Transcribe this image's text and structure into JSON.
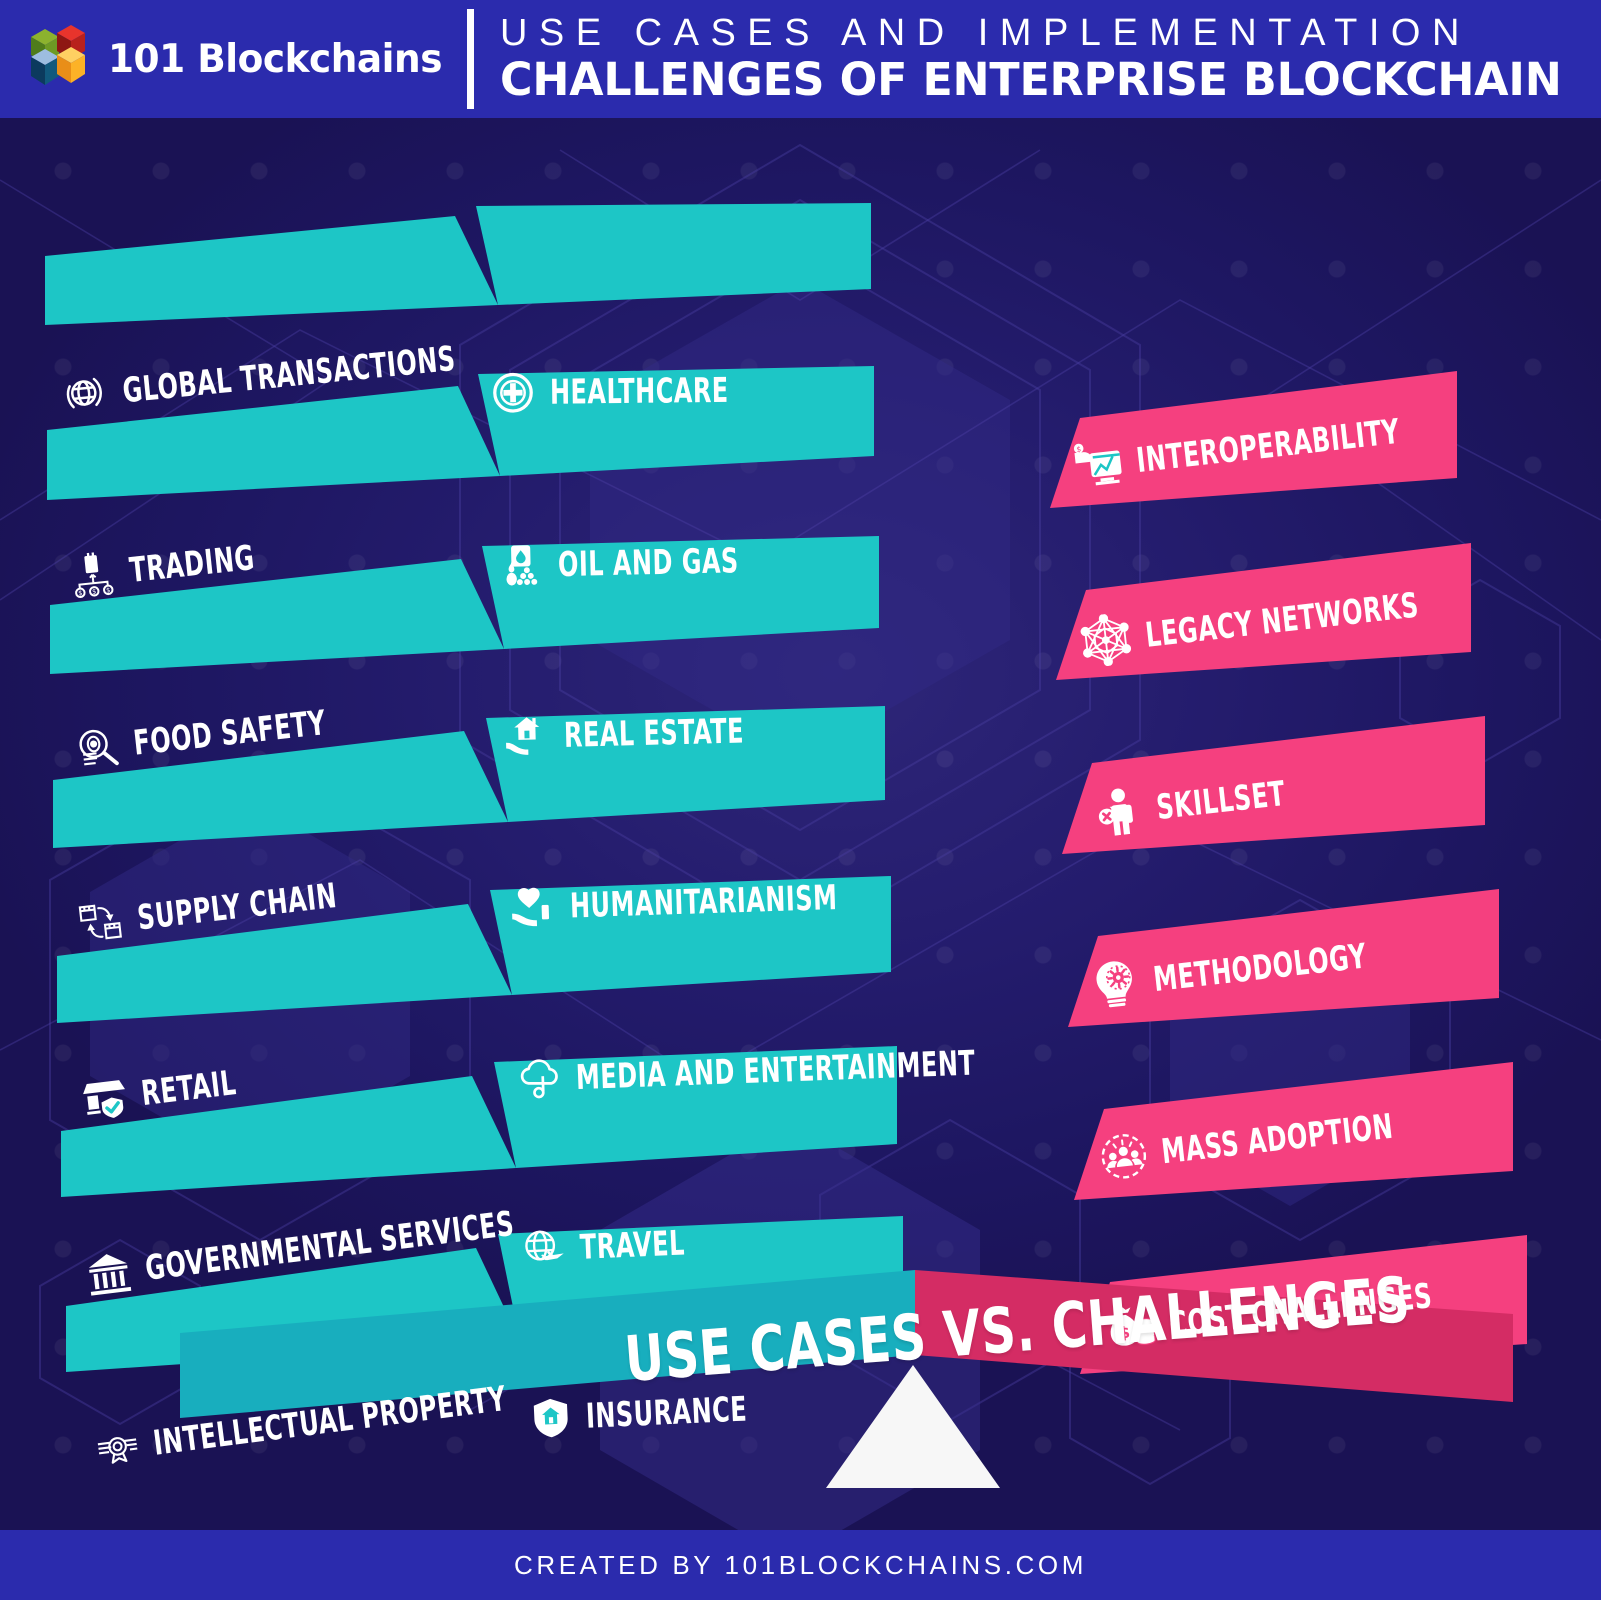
{
  "header": {
    "logo_text": "101 Blockchains",
    "logo_icon": "blockchain-cubes-logo",
    "title_line1": "USE CASES AND IMPLEMENTATION",
    "title_line2": "CHALLENGES OF ENTERPRISE BLOCKCHAIN"
  },
  "footer": {
    "text": "CREATED BY 101BLOCKCHAINS.COM"
  },
  "colors": {
    "background": "#241c6d",
    "header_bar": "#2b2bad",
    "use_case_teal": "#1dc6c6",
    "challenge_pink": "#f5407f",
    "seesaw_teal": "#18aebe",
    "seesaw_pink": "#d42c64",
    "text": "#ffffff"
  },
  "use_cases": {
    "left_column": [
      {
        "label": "GLOBAL TRANSACTIONS",
        "icon": "globe-icon"
      },
      {
        "label": "TRADING",
        "icon": "trading-building-icon"
      },
      {
        "label": "FOOD SAFETY",
        "icon": "food-inspection-icon"
      },
      {
        "label": "SUPPLY CHAIN",
        "icon": "supply-chain-icon"
      },
      {
        "label": "RETAIL",
        "icon": "retail-store-icon"
      },
      {
        "label": "GOVERNMENTAL SERVICES",
        "icon": "government-building-icon"
      },
      {
        "label": "INTELLECTUAL PROPERTY",
        "icon": "certificate-icon"
      }
    ],
    "right_column": [
      {
        "label": "HEALTHCARE",
        "icon": "medical-cross-icon"
      },
      {
        "label": "OIL AND GAS",
        "icon": "oil-barrel-icon"
      },
      {
        "label": "REAL ESTATE",
        "icon": "house-in-hand-icon"
      },
      {
        "label": "HUMANITARIANISM",
        "icon": "heart-in-hand-icon"
      },
      {
        "label": "MEDIA AND ENTERTAINMENT",
        "icon": "cloud-music-icon"
      },
      {
        "label": "TRAVEL",
        "icon": "globe-airplane-icon"
      },
      {
        "label": "INSURANCE",
        "icon": "shield-house-icon"
      }
    ]
  },
  "challenges": [
    {
      "label": "INTEROPERABILITY",
      "icon": "monitor-chart-icon"
    },
    {
      "label": "LEGACY NETWORKS",
      "icon": "network-nodes-icon"
    },
    {
      "label": "SKILLSET",
      "icon": "person-no-skill-icon"
    },
    {
      "label": "METHODOLOGY",
      "icon": "lightbulb-gear-icon"
    },
    {
      "label": "MASS ADOPTION",
      "icon": "crowd-people-icon"
    },
    {
      "label": "COST CHALLENGES",
      "icon": "money-bag-coins-icon"
    }
  ],
  "seesaw": {
    "title": "USE CASES VS. CHALLENGES",
    "fulcrum_icon": "triangle-fulcrum"
  }
}
